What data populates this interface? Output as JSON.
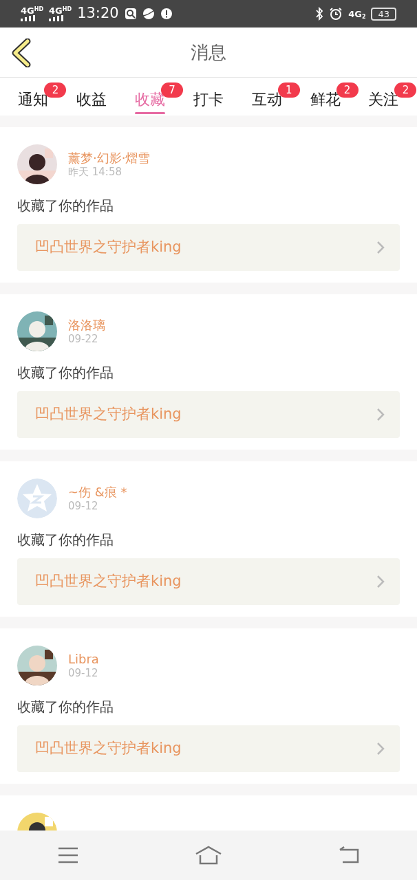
{
  "status_bar": {
    "carriers": [
      {
        "label": "4G",
        "sup": "HD"
      },
      {
        "label": "4G",
        "sup": "HD"
      }
    ],
    "time": "13:20",
    "network": {
      "label": "4G",
      "sub": "2"
    },
    "battery": "43"
  },
  "header": {
    "title": "消息"
  },
  "tabs": [
    {
      "label": "通知",
      "badge": "2",
      "selected": false
    },
    {
      "label": "收益",
      "selected": false
    },
    {
      "label": "收藏",
      "badge": "7",
      "selected": true
    },
    {
      "label": "打卡",
      "selected": false
    },
    {
      "label": "互动",
      "badge": "1",
      "selected": false
    },
    {
      "label": "鲜花",
      "badge": "2",
      "selected": false
    },
    {
      "label": "关注",
      "badge": "2",
      "selected": false
    }
  ],
  "messages": [
    {
      "avatar": {
        "kind": "picture"
      },
      "name": "薰梦·幻影·熠雪",
      "time": "昨天 14:58",
      "text": "收藏了你的作品",
      "work": "凹凸世界之守护者king"
    },
    {
      "avatar": {
        "kind": "picture"
      },
      "name": "洛洛璃",
      "time": "09-22",
      "text": "收藏了你的作品",
      "work": "凹凸世界之守护者king"
    },
    {
      "avatar": {
        "kind": "default"
      },
      "name": "~伤 &痕 *",
      "time": "09-12",
      "text": "收藏了你的作品",
      "work": "凹凸世界之守护者king"
    },
    {
      "avatar": {
        "kind": "picture"
      },
      "name": "Libra",
      "time": "09-12",
      "text": "收藏了你的作品",
      "work": "凹凸世界之守护者king"
    },
    {
      "avatar": {
        "kind": "picture"
      }
    }
  ]
}
